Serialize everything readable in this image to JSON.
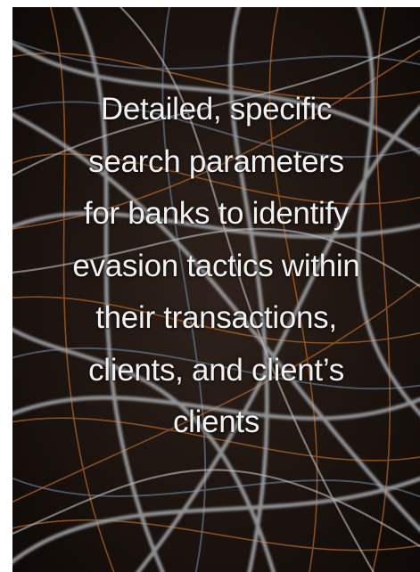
{
  "card": {
    "caption_lines": [
      "Detailed, specific",
      "search parameters",
      "for banks to identify",
      "evasion tactics within",
      "their transactions,",
      "clients, and client’s",
      "clients"
    ]
  },
  "colors": {
    "background": "#1e1612",
    "strand_light": "#c9ccd2",
    "strand_blue": "#8fa8c8",
    "strand_orange": "#d2782e",
    "text": "#f1f1f1"
  }
}
